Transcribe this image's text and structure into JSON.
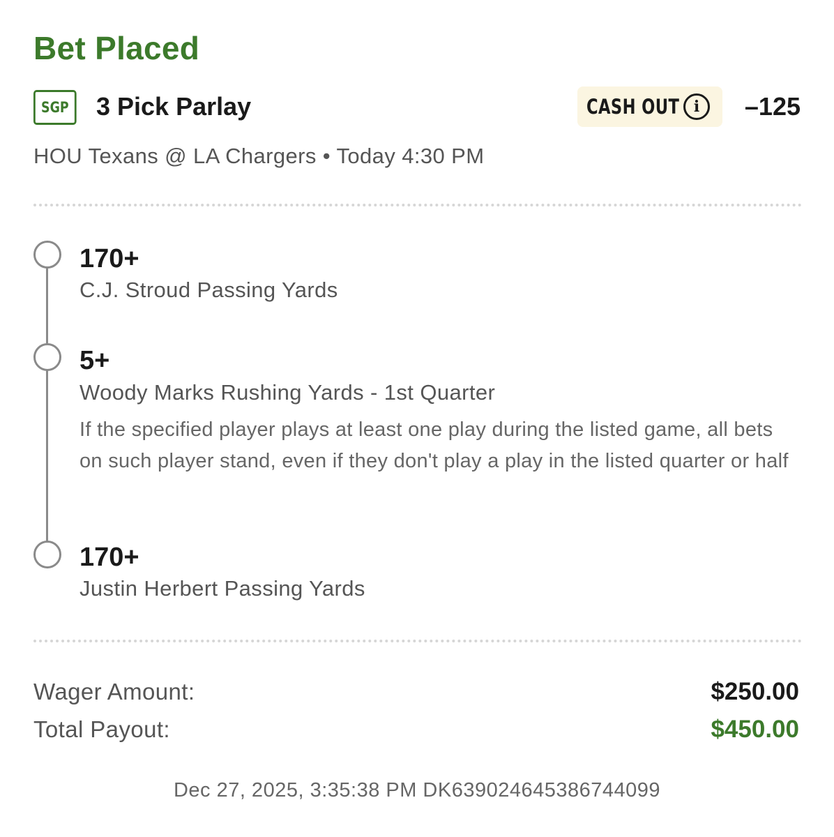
{
  "status_title": "Bet Placed",
  "bet": {
    "badge": "SGP",
    "name": "3 Pick Parlay",
    "cash_out_label": "CASH OUT",
    "odds": "–125",
    "matchup": "HOU Texans @ LA Chargers • Today 4:30 PM"
  },
  "legs": [
    {
      "value": "170+",
      "market": "C.J. Stroud Passing Yards"
    },
    {
      "value": "5+",
      "market": "Woody Marks Rushing Yards - 1st Quarter",
      "note": "If the specified player plays at least one play during the listed game, all bets on such player stand, even if they don't play a play in the listed quarter or half"
    },
    {
      "value": "170+",
      "market": "Justin Herbert Passing Yards"
    }
  ],
  "summary": {
    "wager_label": "Wager Amount:",
    "wager_value": "$250.00",
    "payout_label": "Total Payout:",
    "payout_value": "$450.00"
  },
  "footer": "Dec 27, 2025, 3:35:38 PM DK639024645386744099",
  "colors": {
    "accent_green": "#3c7a2b",
    "cash_out_bg": "#fbf5e1"
  },
  "icons": {
    "cash_out_info": "info-icon"
  }
}
